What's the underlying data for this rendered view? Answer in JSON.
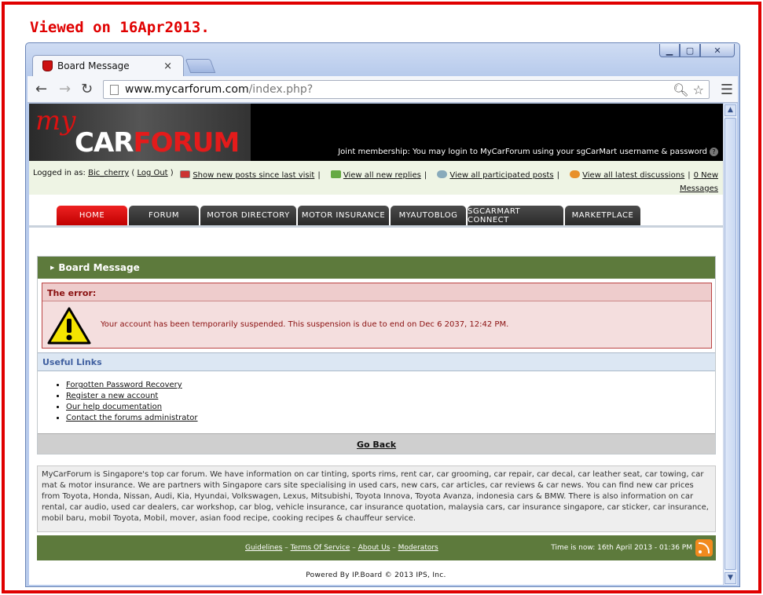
{
  "annotation": "Viewed on 16Apr2013.",
  "browser": {
    "tab_title": "Board Message",
    "tab_close": "×",
    "url_host": "www.mycarforum.com",
    "url_path": "/index.php?"
  },
  "banner": {
    "logo_my": "my",
    "logo_car": "CAR",
    "logo_forum": "FORUM",
    "membership_text": "Joint membership: You may login to MyCarForum using your sgCarMart username & password"
  },
  "userbar": {
    "logged_in_prefix": "Logged in as: ",
    "username": "Bic_cherry",
    "logout_open": " ( ",
    "logout": "Log Out",
    "logout_close": " )",
    "show_new_posts": "Show new posts since last visit",
    "view_new_replies": "View all new replies",
    "view_participated": "View all participated posts",
    "view_latest": "View all latest discussions",
    "new_messages_line1": "0 New",
    "new_messages_line2": "Messages"
  },
  "nav": {
    "tabs": [
      {
        "label": "HOME"
      },
      {
        "label": "FORUM"
      },
      {
        "label": "MOTOR DIRECTORY"
      },
      {
        "label": "MOTOR INSURANCE"
      },
      {
        "label": "MYAUTOBLOG"
      },
      {
        "label": "SGCARMART CONNECT"
      },
      {
        "label": "MARKETPLACE"
      }
    ],
    "active": "HOME"
  },
  "board": {
    "title": "Board Message",
    "error_title": "The error:",
    "error_message": "Your account has been temporarily suspended. This suspension is due to end on Dec 6 2037, 12:42 PM.",
    "useful_links_title": "Useful Links",
    "links": [
      {
        "label": "Forgotten Password Recovery"
      },
      {
        "label": "Register a new account"
      },
      {
        "label": "Our help documentation"
      },
      {
        "label": "Contact the forums administrator"
      }
    ],
    "go_back": "Go Back"
  },
  "seo_text": "MyCarForum is Singapore's top car forum. We have information on car tinting, sports rims, rent car, car grooming, car repair, car decal, car leather seat, car towing, car mat & motor insurance. We are partners with Singapore cars site specialising in used cars, new cars, car articles, car reviews & car news. You can find new car prices from Toyota, Honda, Nissan, Audi, Kia, Hyundai, Volkswagen, Lexus, Mitsubishi, Toyota Innova, Toyota Avanza, indonesia cars & BMW. There is also information on car rental, car audio, used car dealers, car workshop, car blog, vehicle insurance, car insurance quotation, malaysia cars, car insurance singapore, car sticker, car insurance, mobil baru, mobil Toyota, Mobil, mover, asian food recipe, cooking recipes & chauffeur service.",
  "footer": {
    "guidelines": "Guidelines",
    "terms": "Terms Of Service",
    "about": "About Us",
    "moderators": "Moderators",
    "dash": " – ",
    "time": "Time is now: 16th April 2013 - 01:36 PM",
    "powered": "Powered By IP.Board © 2013  IPS, Inc."
  }
}
